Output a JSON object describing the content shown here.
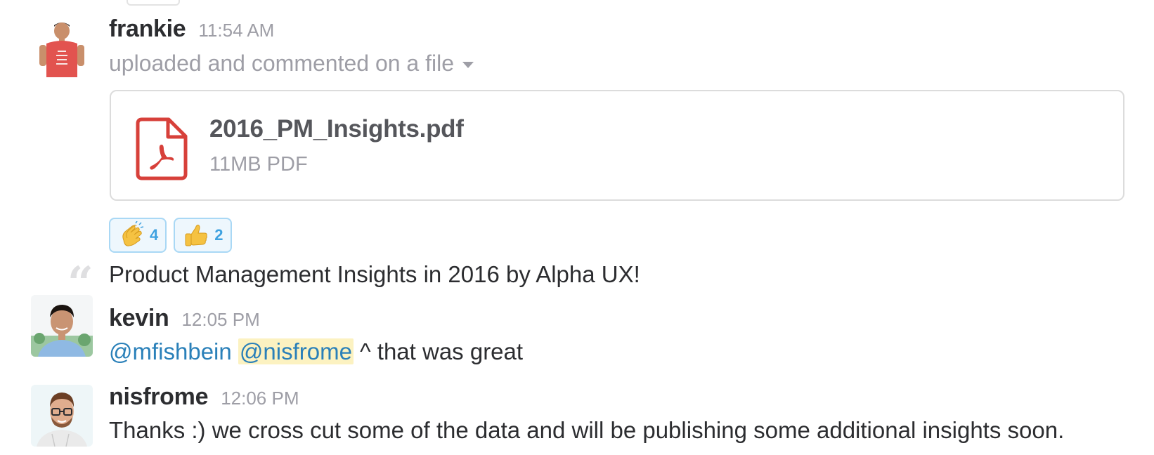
{
  "colors": {
    "mention": "#2a80b9",
    "mention_highlight": "#fcf2c1",
    "pdf_red": "#d7403a",
    "reaction_border": "#a9d8f5",
    "reaction_count": "#3fa2e0"
  },
  "messages": [
    {
      "sender": "frankie",
      "time": "11:54 AM",
      "subtitle": "uploaded and commented on a file",
      "file": {
        "icon": "pdf-icon",
        "name": "2016_PM_Insights.pdf",
        "meta": "11MB PDF"
      },
      "reactions": [
        {
          "emoji": "clapping-hands",
          "count": "4"
        },
        {
          "emoji": "thumbs-up",
          "count": "2"
        }
      ],
      "comment": "Product Management Insights in 2016 by Alpha UX!"
    },
    {
      "sender": "kevin",
      "time": "12:05 PM",
      "mention_1": "@mfishbein",
      "mention_2": "@nisfrome",
      "text": "^ that was great"
    },
    {
      "sender": "nisfrome",
      "time": "12:06 PM",
      "text": "Thanks :) we cross cut some of the data and will be publishing some additional insights soon."
    }
  ]
}
